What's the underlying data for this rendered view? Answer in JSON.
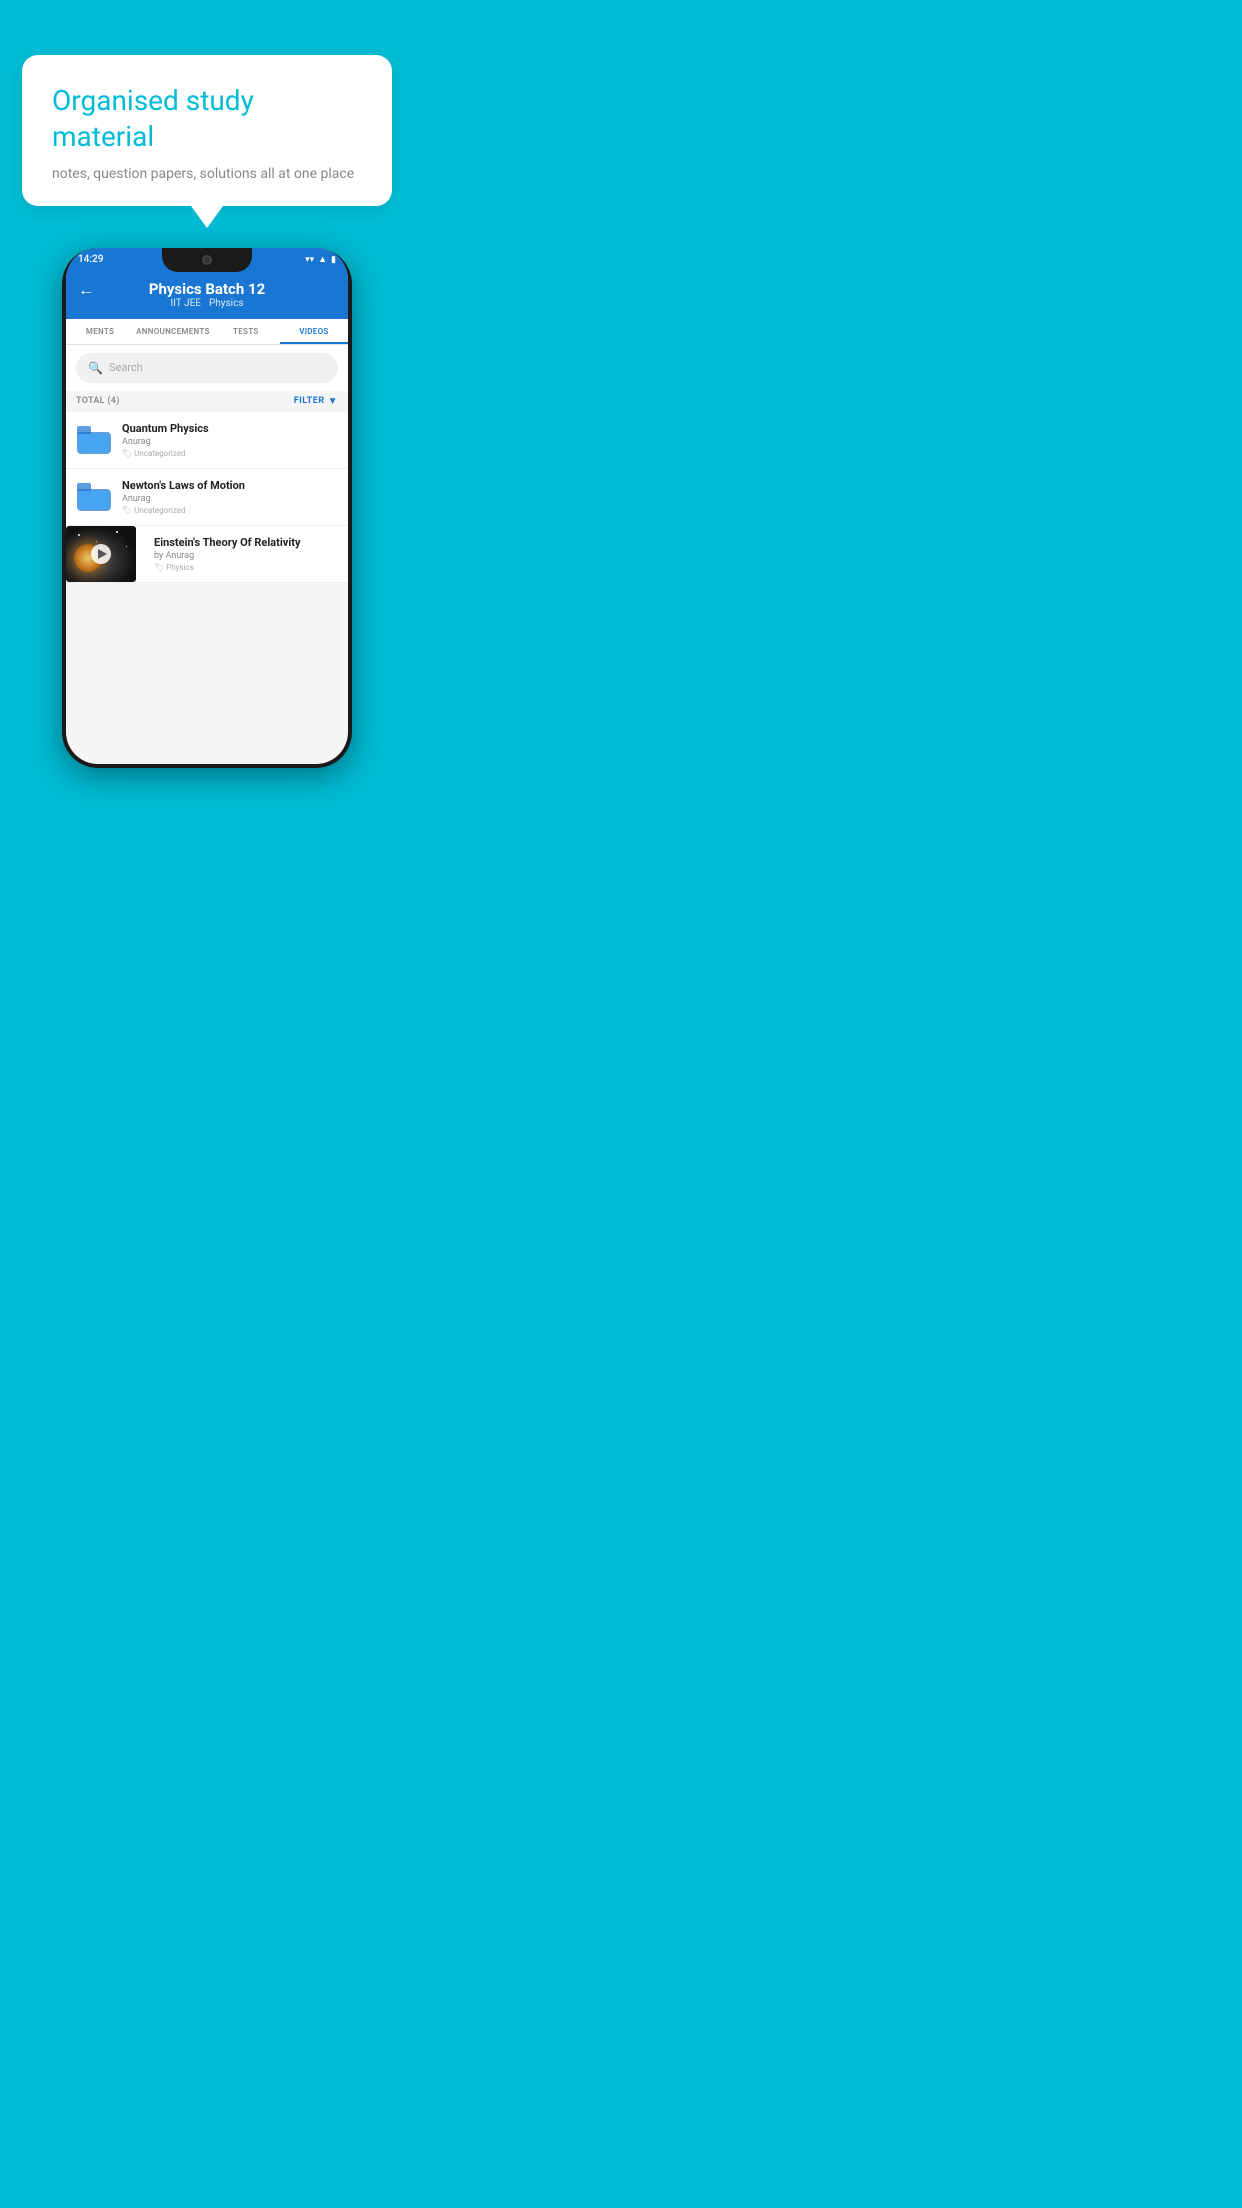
{
  "background_color": "#00bcd4",
  "speech_bubble": {
    "title": "Organised study material",
    "subtitle": "notes, question papers, solutions all at one place"
  },
  "phone": {
    "status_bar": {
      "time": "14:29",
      "icons": [
        "wifi",
        "signal",
        "battery"
      ]
    },
    "app_bar": {
      "back_icon": "←",
      "title": "Physics Batch 12",
      "subtitle_items": [
        "IIT JEE",
        "Physics"
      ]
    },
    "tabs": [
      {
        "label": "MENTS",
        "active": false
      },
      {
        "label": "ANNOUNCEMENTS",
        "active": false
      },
      {
        "label": "TESTS",
        "active": false
      },
      {
        "label": "VIDEOS",
        "active": true
      }
    ],
    "search": {
      "placeholder": "Search",
      "search_icon": "🔍"
    },
    "filter_row": {
      "total_label": "TOTAL (4)",
      "filter_label": "FILTER"
    },
    "video_list": [
      {
        "title": "Quantum Physics",
        "author": "Anurag",
        "tag": "Uncategorized",
        "type": "folder"
      },
      {
        "title": "Newton's Laws of Motion",
        "author": "Anurag",
        "tag": "Uncategorized",
        "type": "folder"
      },
      {
        "title": "Einstein's Theory Of Relativity",
        "author": "by Anurag",
        "tag": "Physics",
        "type": "video"
      }
    ]
  }
}
